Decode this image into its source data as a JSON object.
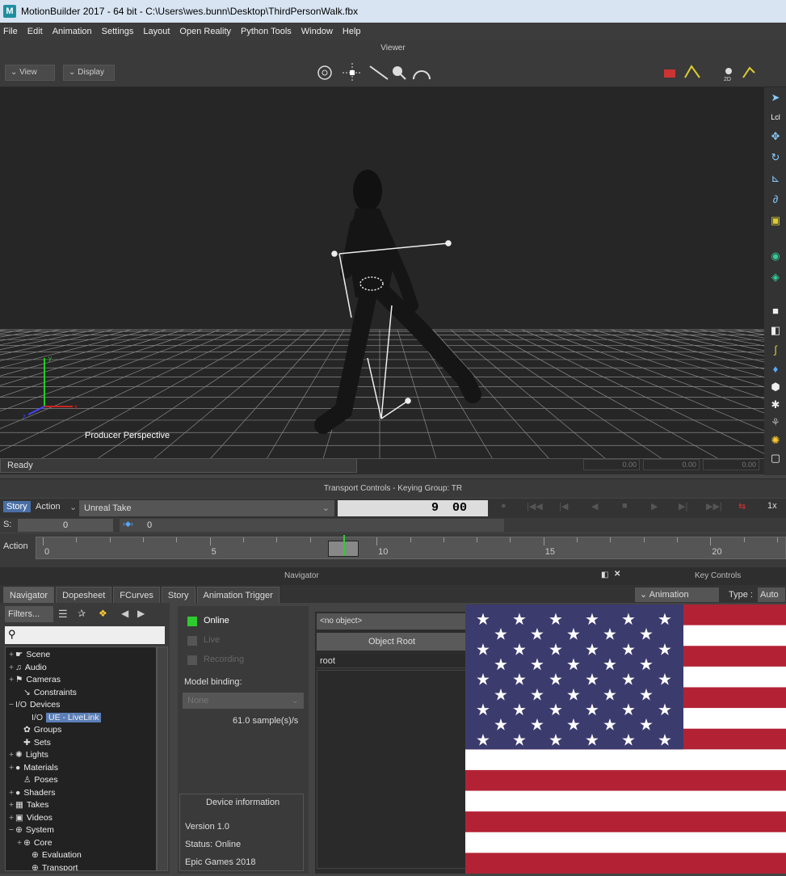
{
  "window": {
    "title": "MotionBuilder 2017   - 64 bit  - C:\\Users\\wes.bunn\\Desktop\\ThirdPersonWalk.fbx",
    "logo": "M"
  },
  "menu": [
    "File",
    "Edit",
    "Animation",
    "Settings",
    "Layout",
    "Open Reality",
    "Python Tools",
    "Window",
    "Help"
  ],
  "viewer": {
    "strip_label": "Viewer",
    "view_btn": "View",
    "display_btn": "Display",
    "camera_label": "Producer Perspective",
    "status": "Ready",
    "coords": [
      "0.00",
      "0.00",
      "0.00"
    ],
    "axis_labels": [
      "x",
      "y",
      "z"
    ],
    "mode_2d": "2D",
    "right_tool_top": "Lcl"
  },
  "transport": {
    "header": "Transport Controls  -  Keying Group: TR",
    "story_tab": "Story",
    "action_tab": "Action",
    "take": "Unreal Take",
    "frame": "9",
    "subframe": "00",
    "speed": "1x",
    "s_label": "S:",
    "s_value": "0",
    "s_value2": "0",
    "action_label": "Action",
    "ruler_labels": [
      "0",
      "5",
      "10",
      "15",
      "20"
    ],
    "current_frame": 9,
    "ruler_max": 22
  },
  "navigator": {
    "header": "Navigator",
    "key_controls_header": "Key Controls",
    "tabs": [
      "Navigator",
      "Dopesheet",
      "FCurves",
      "Story",
      "Animation Trigger"
    ],
    "active_tab": "Navigator",
    "filters": "Filters...",
    "tree": [
      {
        "prefix": "+",
        "icon": "☛",
        "label": "Scene",
        "indent": 0
      },
      {
        "prefix": "+",
        "icon": "♫",
        "label": "Audio",
        "indent": 0
      },
      {
        "prefix": "+",
        "icon": "⚑",
        "label": "Cameras",
        "indent": 0
      },
      {
        "prefix": "",
        "icon": "↘",
        "label": "Constraints",
        "indent": 1
      },
      {
        "prefix": "−",
        "icon": "I/O",
        "label": "Devices",
        "indent": 0
      },
      {
        "prefix": "",
        "icon": "I/O",
        "label": "UE - LiveLink",
        "indent": 2,
        "selected": true
      },
      {
        "prefix": "",
        "icon": "✿",
        "label": "Groups",
        "indent": 1
      },
      {
        "prefix": "",
        "icon": "✚",
        "label": "Sets",
        "indent": 1
      },
      {
        "prefix": "+",
        "icon": "✺",
        "label": "Lights",
        "indent": 0
      },
      {
        "prefix": "+",
        "icon": "●",
        "label": "Materials",
        "indent": 0
      },
      {
        "prefix": "",
        "icon": "♙",
        "label": "Poses",
        "indent": 1
      },
      {
        "prefix": "+",
        "icon": "●",
        "label": "Shaders",
        "indent": 0
      },
      {
        "prefix": "+",
        "icon": "▦",
        "label": "Takes",
        "indent": 0
      },
      {
        "prefix": "+",
        "icon": "▣",
        "label": "Videos",
        "indent": 0
      },
      {
        "prefix": "−",
        "icon": "⊕",
        "label": "System",
        "indent": 0
      },
      {
        "prefix": "+",
        "icon": "⊕",
        "label": "Core",
        "indent": 1
      },
      {
        "prefix": "",
        "icon": "⊕",
        "label": "Evaluation",
        "indent": 2
      },
      {
        "prefix": "",
        "icon": "⊕",
        "label": "Transport",
        "indent": 2
      }
    ]
  },
  "animation_panel": {
    "label": "Animation",
    "type_label": "Type :",
    "type_value": "Auto"
  },
  "device": {
    "online": "Online",
    "live": "Live",
    "recording": "Recording",
    "model_binding": "Model binding:",
    "binding_value": "None",
    "sample_rate": "61.0 sample(s)/s",
    "info_title": "Device information",
    "version": "Version 1.0",
    "status": "Status: Online",
    "vendor": "Epic Games 2018"
  },
  "object_panel": {
    "select": "<no object>",
    "root_btn": "Object Root",
    "root_item": "root"
  },
  "colors": {
    "flag_red": "#b22234",
    "flag_blue": "#3c3b6e",
    "online_green": "#2ecc2e"
  }
}
